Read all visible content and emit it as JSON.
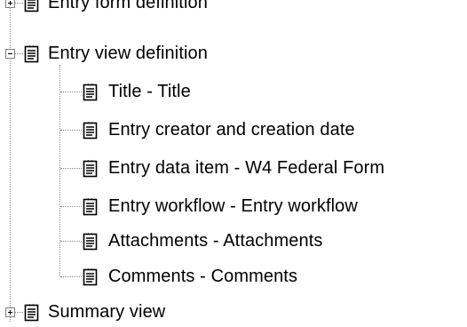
{
  "tree": {
    "nodes": [
      {
        "label": "Entry form definition",
        "state": "collapsed",
        "icon": "document-icon"
      },
      {
        "label": "Entry view definition",
        "state": "expanded",
        "icon": "document-icon"
      },
      {
        "label": "Title - Title",
        "state": "leaf",
        "icon": "document-icon"
      },
      {
        "label": "Entry creator and creation date",
        "state": "leaf",
        "icon": "document-icon"
      },
      {
        "label": "Entry data item - W4 Federal Form",
        "state": "leaf",
        "icon": "document-icon"
      },
      {
        "label": "Entry workflow - Entry workflow",
        "state": "leaf",
        "icon": "document-icon"
      },
      {
        "label": "Attachments - Attachments",
        "state": "leaf",
        "icon": "document-icon"
      },
      {
        "label": "Comments - Comments",
        "state": "leaf",
        "icon": "document-icon"
      },
      {
        "label": "Summary view",
        "state": "collapsed",
        "icon": "document-icon"
      }
    ]
  },
  "colors": {
    "connector": "#8a8a8a",
    "expander_border": "#808080",
    "text": "#000000"
  }
}
